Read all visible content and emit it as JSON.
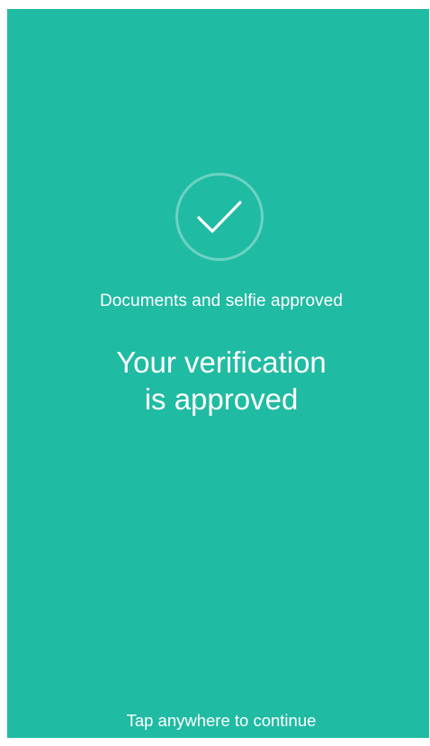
{
  "screen": {
    "background_color": "#20bba3",
    "check_icon": "checkmark-circle-icon",
    "subtitle": "Documents and selfie approved",
    "headline_line1": "Your verification",
    "headline_line2": "is approved",
    "footer": "Tap anywhere to continue"
  }
}
